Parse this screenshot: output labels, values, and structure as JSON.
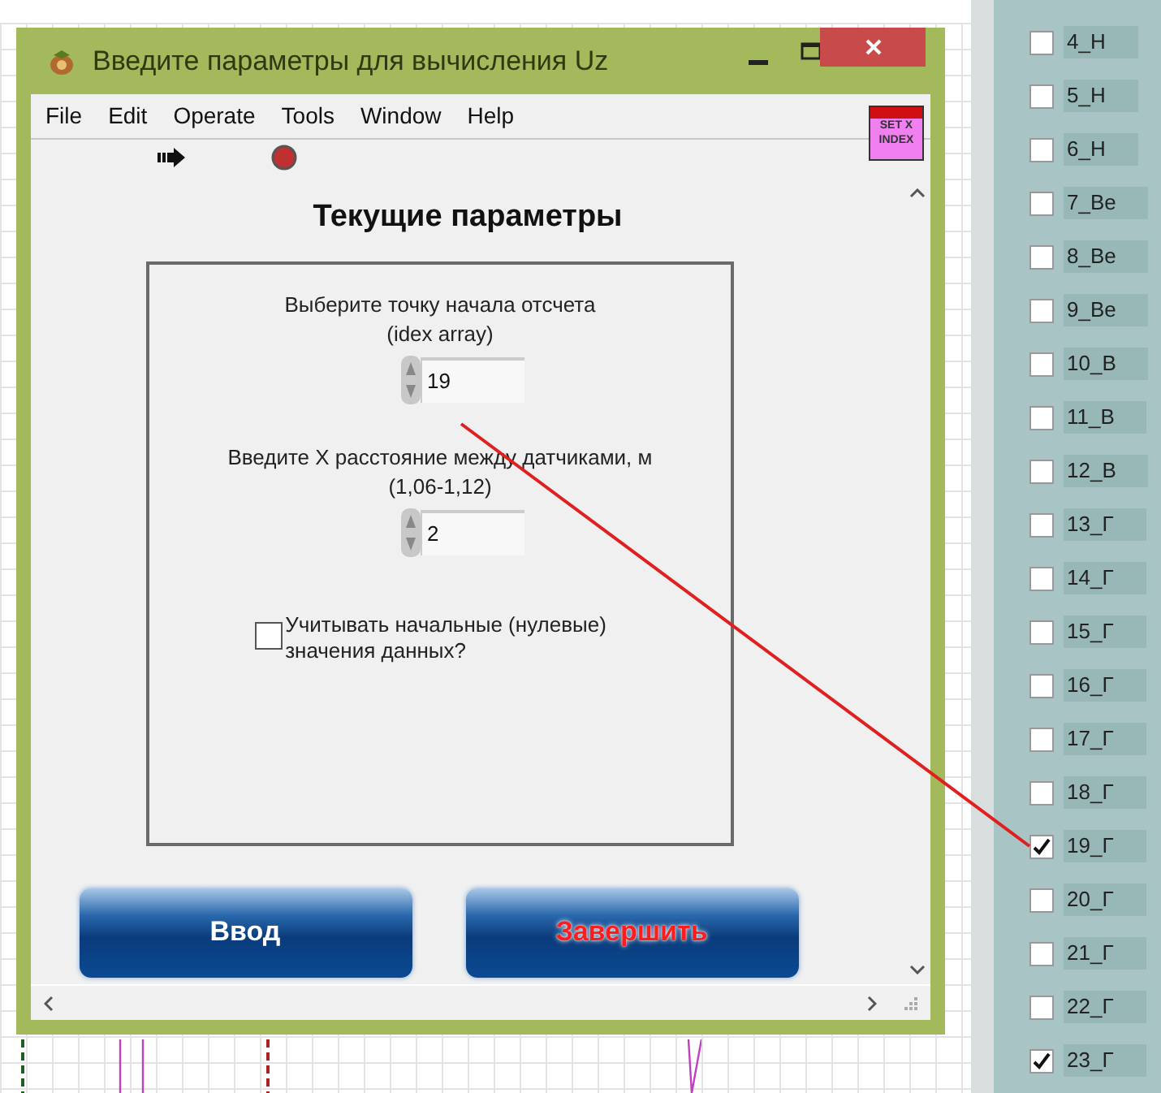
{
  "window": {
    "title": "Введите параметры для вычисления Uz"
  },
  "menu": [
    "File",
    "Edit",
    "Operate",
    "Tools",
    "Window",
    "Help"
  ],
  "badge": {
    "label": "SET X\nINDEX"
  },
  "heading": "Текущие параметры",
  "fields": [
    {
      "label": "Выберите точку начала отсчета",
      "hint": "(idex array)",
      "value": "19"
    },
    {
      "label": "Введите X расстояние между датчиками, м",
      "hint": "(1,06-1,12)",
      "value": "2"
    }
  ],
  "option": {
    "label": "Учитывать начальные (нулевые)\nзначения данных?",
    "checked": false
  },
  "buttons": [
    {
      "label": "Ввод",
      "kind": "normal"
    },
    {
      "label": "Завершить",
      "kind": "danger"
    }
  ],
  "channels": [
    {
      "label": "4_Н",
      "checked": false
    },
    {
      "label": "5_Н",
      "checked": false
    },
    {
      "label": "6_Н",
      "checked": false
    },
    {
      "label": "7_Ве",
      "checked": false
    },
    {
      "label": "8_Ве",
      "checked": false
    },
    {
      "label": "9_Ве",
      "checked": false
    },
    {
      "label": "10_В",
      "checked": false
    },
    {
      "label": "11_В",
      "checked": false
    },
    {
      "label": "12_В",
      "checked": false
    },
    {
      "label": "13_Г",
      "checked": false
    },
    {
      "label": "14_Г",
      "checked": false
    },
    {
      "label": "15_Г",
      "checked": false
    },
    {
      "label": "16_Г",
      "checked": false
    },
    {
      "label": "17_Г",
      "checked": false
    },
    {
      "label": "18_Г",
      "checked": false
    },
    {
      "label": "19_Г",
      "checked": true
    },
    {
      "label": "20_Г",
      "checked": false
    },
    {
      "label": "21_Г",
      "checked": false
    },
    {
      "label": "22_Г",
      "checked": false
    },
    {
      "label": "23_Г",
      "checked": true
    }
  ]
}
